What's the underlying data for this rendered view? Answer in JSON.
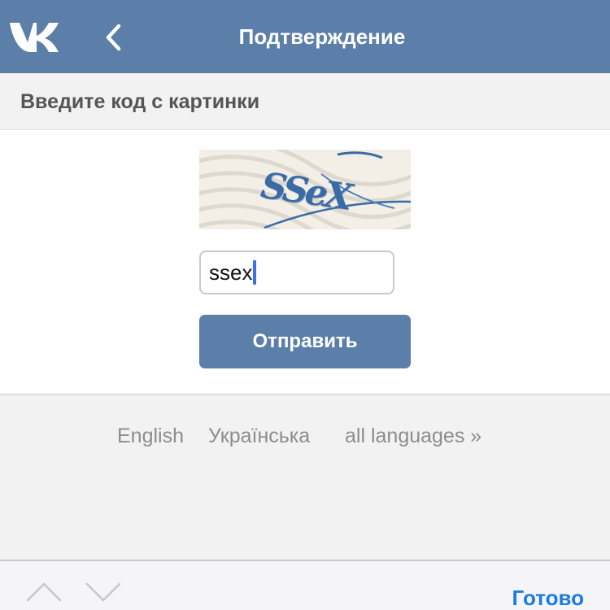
{
  "header": {
    "logo_icon": "vk-logo-icon",
    "back_icon": "chevron-left-icon",
    "title": "Подтверждение",
    "background_color": "#5b7fa8"
  },
  "section": {
    "heading": "Введите код с картинки"
  },
  "captcha": {
    "image_text": "SSeX"
  },
  "code_input": {
    "value": "ssex"
  },
  "submit_button": {
    "label": "Отправить",
    "color": "#5b7fa8"
  },
  "languages": {
    "items": [
      "English",
      "Українська",
      "all languages »"
    ]
  },
  "keyboard_bar": {
    "prev_icon": "chevron-up-icon",
    "next_icon": "chevron-down-icon",
    "done_label": "Готово",
    "done_color": "#1a7ce0"
  }
}
